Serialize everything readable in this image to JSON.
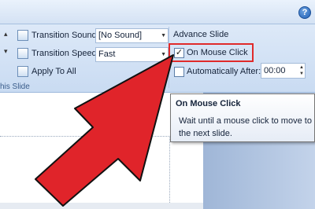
{
  "help_icon": "help-icon",
  "transitions": {
    "sound_label": "Transition Sound:",
    "sound_value": "[No Sound]",
    "speed_label": "Transition Speed:",
    "speed_value": "Fast",
    "apply_all_label": "Apply To All",
    "group_label": "his Slide"
  },
  "advance_slide": {
    "heading": "Advance Slide",
    "on_mouse_click_label": "On Mouse Click",
    "on_mouse_click_checked": true,
    "auto_after_label": "Automatically After:",
    "auto_after_checked": false,
    "auto_after_value": "00:00"
  },
  "tooltip": {
    "title": "On Mouse Click",
    "body": "Wait until a mouse click to move to the next slide."
  },
  "colors": {
    "arrow": "#e0242a",
    "highlight": "#e02a2a",
    "ribbon": "#d4e2f4"
  }
}
